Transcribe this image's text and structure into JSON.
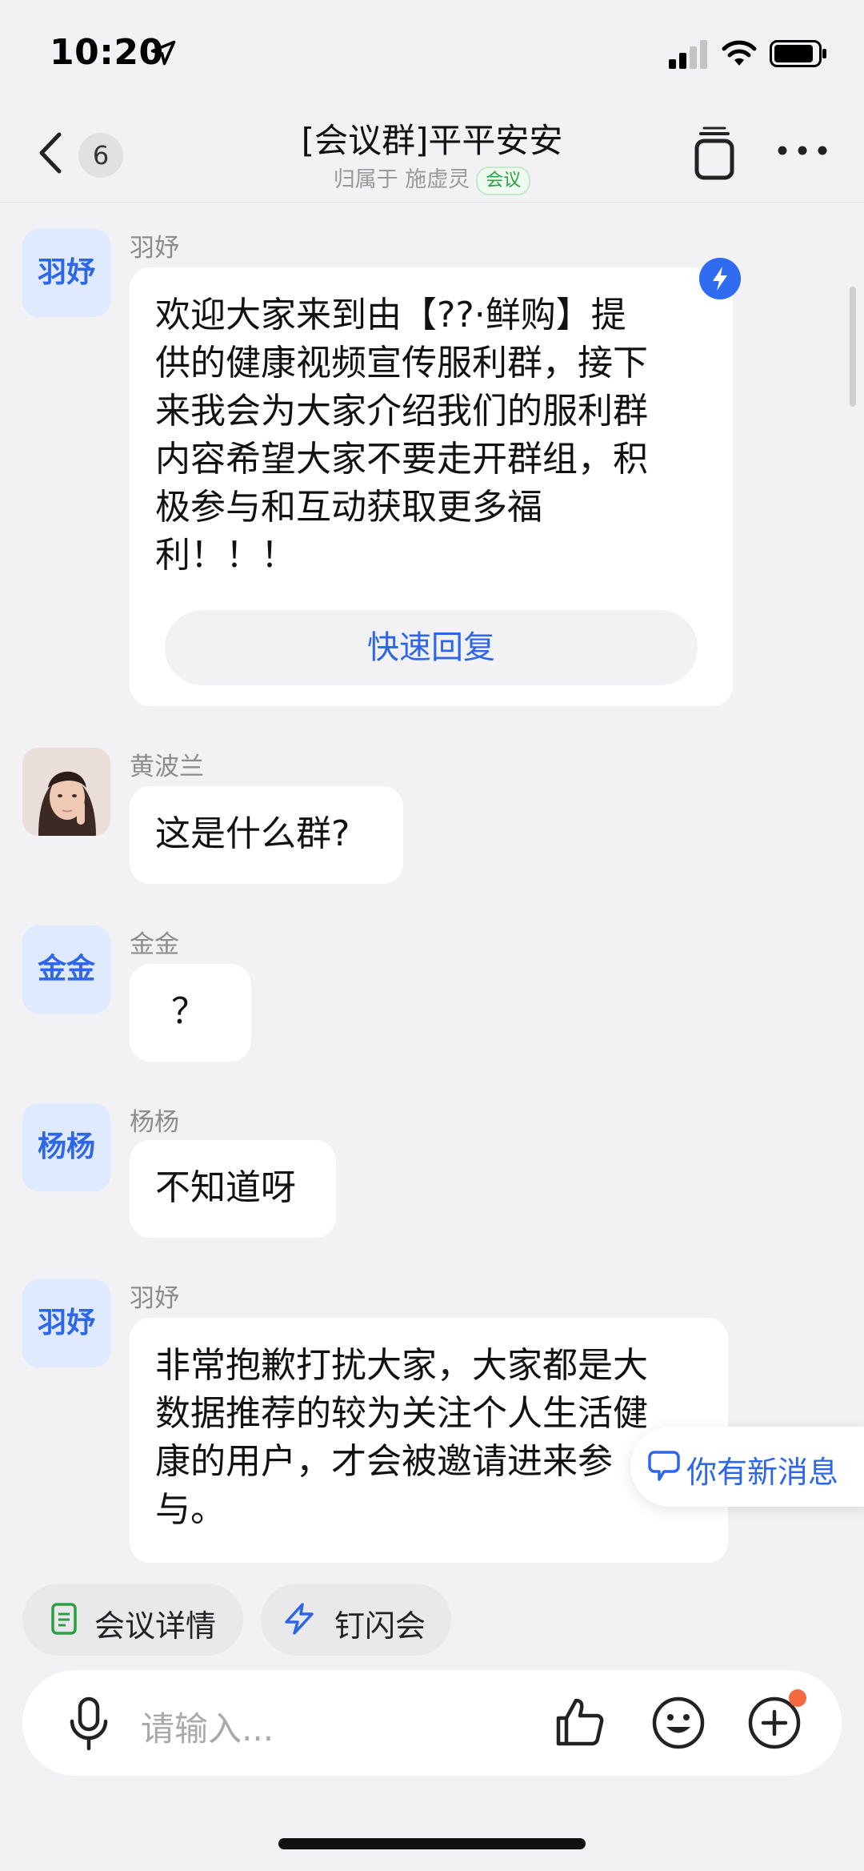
{
  "status": {
    "time": "10:20"
  },
  "header": {
    "back_count": "6",
    "title": "[会议群]平平安安",
    "owner_prefix": "归属于 ",
    "owner_name": "施虚灵",
    "tag": "会议"
  },
  "messages": [
    {
      "avatar": "羽妤",
      "sender": "羽妤",
      "text": "欢迎大家来到由【??·鲜购】提\n供的健康视频宣传服利群，接下\n来我会为大家介绍我们的服利群\n内容希望大家不要走开群组，积\n极参与和互动获取更多福\n利！！！",
      "quick_reply": "快速回复"
    },
    {
      "avatar": "photo",
      "sender": "黄波兰",
      "text": "这是什么群?"
    },
    {
      "avatar": "金金",
      "sender": "金金",
      "text": "？"
    },
    {
      "avatar": "杨杨",
      "sender": "杨杨",
      "text": "不知道呀"
    },
    {
      "avatar": "羽妤",
      "sender": "羽妤",
      "text": "非常抱歉打扰大家，大家都是大\n数据推荐的较为关注个人生活健\n康的用户，才会被邀请进来参\n与。"
    }
  ],
  "new_message_label": "你有新消息",
  "chips": [
    {
      "label": "会议详情",
      "icon": "document-icon"
    },
    {
      "label": "钉闪会",
      "icon": "flash-icon"
    }
  ],
  "input": {
    "placeholder": "请输入..."
  },
  "colors": {
    "accent": "#2d66e8",
    "green_tag": "#2aa043",
    "dot": "#f46b3f"
  }
}
